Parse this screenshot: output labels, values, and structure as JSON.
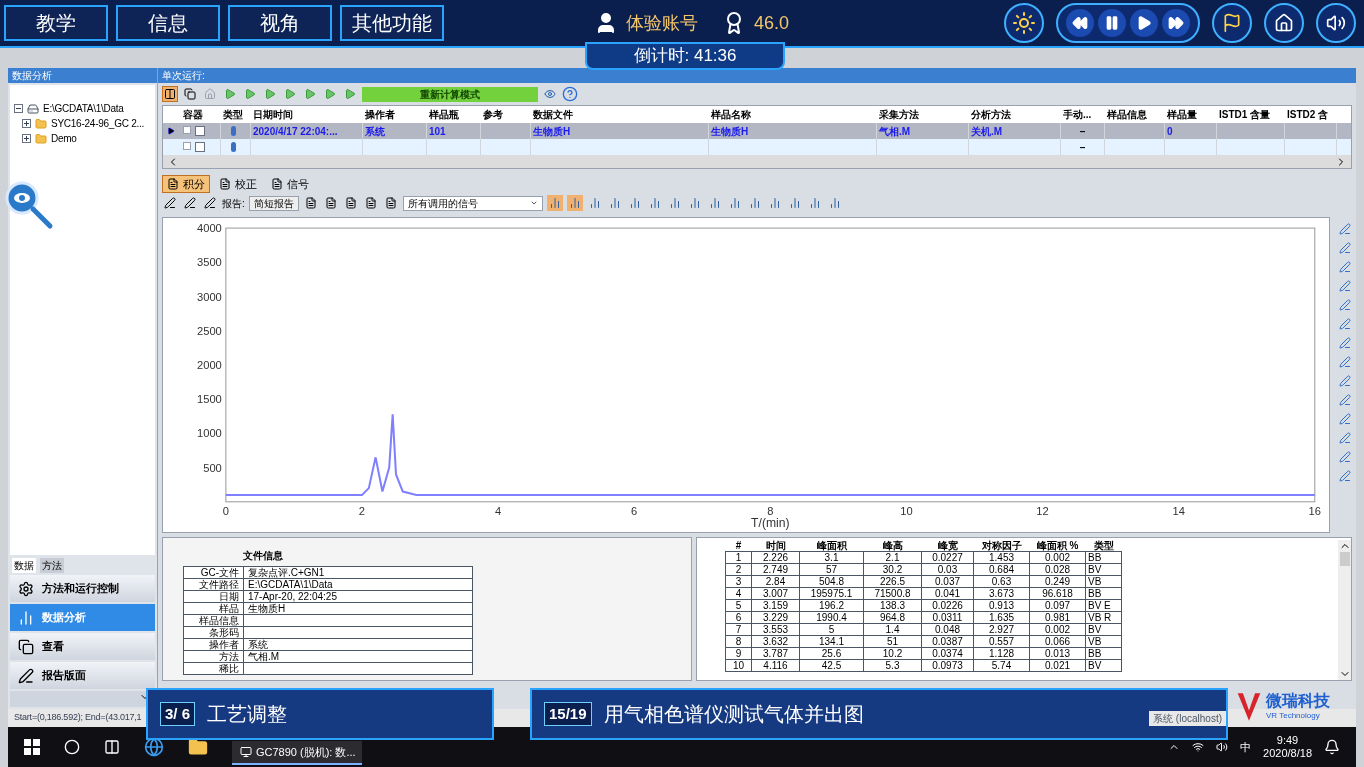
{
  "hud": {
    "tabs": [
      {
        "label": "教学",
        "selected": false
      },
      {
        "label": "信息",
        "selected": false
      },
      {
        "label": "视角",
        "selected": false
      },
      {
        "label": "其他功能",
        "selected": false
      }
    ],
    "account": "体验账号",
    "score": "46.0",
    "countdown": "倒计时: 41:36"
  },
  "sidebar": {
    "title": "数据分析",
    "tree": [
      {
        "label": "E:\\GCDATA\\1\\Data",
        "expanded": true,
        "children": [
          {
            "label": "SYC16-24-96_GC 2...",
            "expanded": false
          },
          {
            "label": "Demo",
            "expanded": false
          }
        ]
      }
    ],
    "tabs": [
      {
        "label": "数据",
        "selected": true
      },
      {
        "label": "方法",
        "selected": false
      }
    ],
    "nav": [
      {
        "label": "方法和运行控制",
        "selected": false
      },
      {
        "label": "数据分析",
        "selected": true
      },
      {
        "label": "查看",
        "selected": false
      },
      {
        "label": "报告版面",
        "selected": false
      }
    ]
  },
  "run": {
    "title": "单次运行:",
    "mode": "重新计算模式",
    "columns": [
      "容器",
      "类型",
      "日期时间",
      "操作者",
      "样品瓶",
      "参考",
      "数据文件",
      "样品名称",
      "采集方法",
      "分析方法",
      "手动...",
      "样品信息",
      "样品量",
      "ISTD1 含量",
      "ISTD2 含"
    ],
    "rows": [
      {
        "selected": true,
        "cells": [
          "",
          "",
          "2020/4/17 22:04:...",
          "系统",
          "101",
          "",
          "生物质H",
          "生物质H",
          "气相.M",
          "关机.M",
          "–",
          "",
          "0",
          "",
          ""
        ]
      },
      {
        "selected": false,
        "cells": [
          "",
          "",
          "",
          "",
          "",
          "",
          "",
          "",
          "",
          "",
          "–",
          "",
          "",
          "",
          ""
        ]
      }
    ]
  },
  "view_tabs": [
    {
      "label": "积分",
      "selected": true
    },
    {
      "label": "校正",
      "selected": false
    },
    {
      "label": "信号",
      "selected": false
    }
  ],
  "report_label": "报告:",
  "report_select": "简短报告",
  "signal_select": "所有调用的信号",
  "chart_data": {
    "type": "line",
    "xlabel": "T/(min)",
    "xlim": [
      0,
      16
    ],
    "ylim": [
      0,
      4000
    ],
    "xticks": [
      0,
      2,
      4,
      6,
      8,
      10,
      12,
      14,
      16
    ],
    "yticks": [
      500,
      1000,
      1500,
      2000,
      2500,
      3000,
      3500,
      4000
    ],
    "x": [
      0,
      1,
      2,
      2.1,
      2.2,
      2.3,
      2.4,
      2.45,
      2.5,
      2.6,
      2.8,
      3,
      4,
      6,
      8,
      10,
      12,
      14,
      16
    ],
    "series": [
      {
        "color": "#8080ff",
        "values": [
          100,
          100,
          100,
          200,
          650,
          150,
          500,
          1280,
          400,
          150,
          100,
          100,
          100,
          100,
          100,
          100,
          100,
          100,
          100
        ]
      }
    ]
  },
  "file_info": {
    "title": "文件信息",
    "rows": [
      {
        "label": "GC-文件",
        "value": "复杂点评.C+GN1"
      },
      {
        "label": "文件路径",
        "value": "E:\\GCDATA\\1\\Data"
      },
      {
        "label": "日期",
        "value": "17-Apr-20, 22:04:25"
      },
      {
        "label": "样品",
        "value": "生物质H"
      },
      {
        "label": "样品信息"
      },
      {
        "label": "条形码"
      },
      {
        "label": "操作者",
        "value": "系统"
      },
      {
        "label": "方法",
        "value": "气相.M"
      },
      {
        "label": "稀比"
      }
    ]
  },
  "peaks": {
    "columns": [
      "#",
      "时间",
      "峰面积",
      "峰高",
      "峰宽",
      "对称因子",
      "峰面积 %",
      "类型"
    ],
    "rows": [
      [
        "1",
        "2.226",
        "3.1",
        "2.1",
        "0.0227",
        "1.453",
        "0.002",
        "BB"
      ],
      [
        "2",
        "2.749",
        "57",
        "30.2",
        "0.03",
        "0.684",
        "0.028",
        "BV"
      ],
      [
        "3",
        "2.84",
        "504.8",
        "226.5",
        "0.037",
        "0.63",
        "0.249",
        "VB"
      ],
      [
        "4",
        "3.007",
        "195975.1",
        "71500.8",
        "0.041",
        "3.673",
        "96.618",
        "BB"
      ],
      [
        "5",
        "3.159",
        "196.2",
        "138.3",
        "0.0226",
        "0.913",
        "0.097",
        "BV E"
      ],
      [
        "6",
        "3.229",
        "1990.4",
        "964.8",
        "0.0311",
        "1.635",
        "0.981",
        "VB R"
      ],
      [
        "7",
        "3.553",
        "5",
        "1.4",
        "0.048",
        "2.927",
        "0.002",
        "BV"
      ],
      [
        "8",
        "3.632",
        "134.1",
        "51",
        "0.0387",
        "0.557",
        "0.066",
        "VB"
      ],
      [
        "9",
        "3.787",
        "25.6",
        "10.2",
        "0.0374",
        "1.128",
        "0.013",
        "BB"
      ],
      [
        "10",
        "4.116",
        "42.5",
        "5.3",
        "0.0973",
        "5.74",
        "0.021",
        "BV"
      ]
    ]
  },
  "status": "Start=(0,186.592); End=(43.017,1",
  "status_user": "系统 (localhost)",
  "steps": [
    {
      "counter": "3/ 6",
      "label": "工艺调整"
    },
    {
      "counter": "15/19",
      "label": "用气相色谱仪测试气体并出图"
    }
  ],
  "logo": {
    "name": "微瑞科技",
    "sub": "VR Technology"
  },
  "taskbar": {
    "app": "GC7890 (脱机): 数...",
    "ime": "中",
    "time": "9:49",
    "date": "2020/8/18"
  }
}
